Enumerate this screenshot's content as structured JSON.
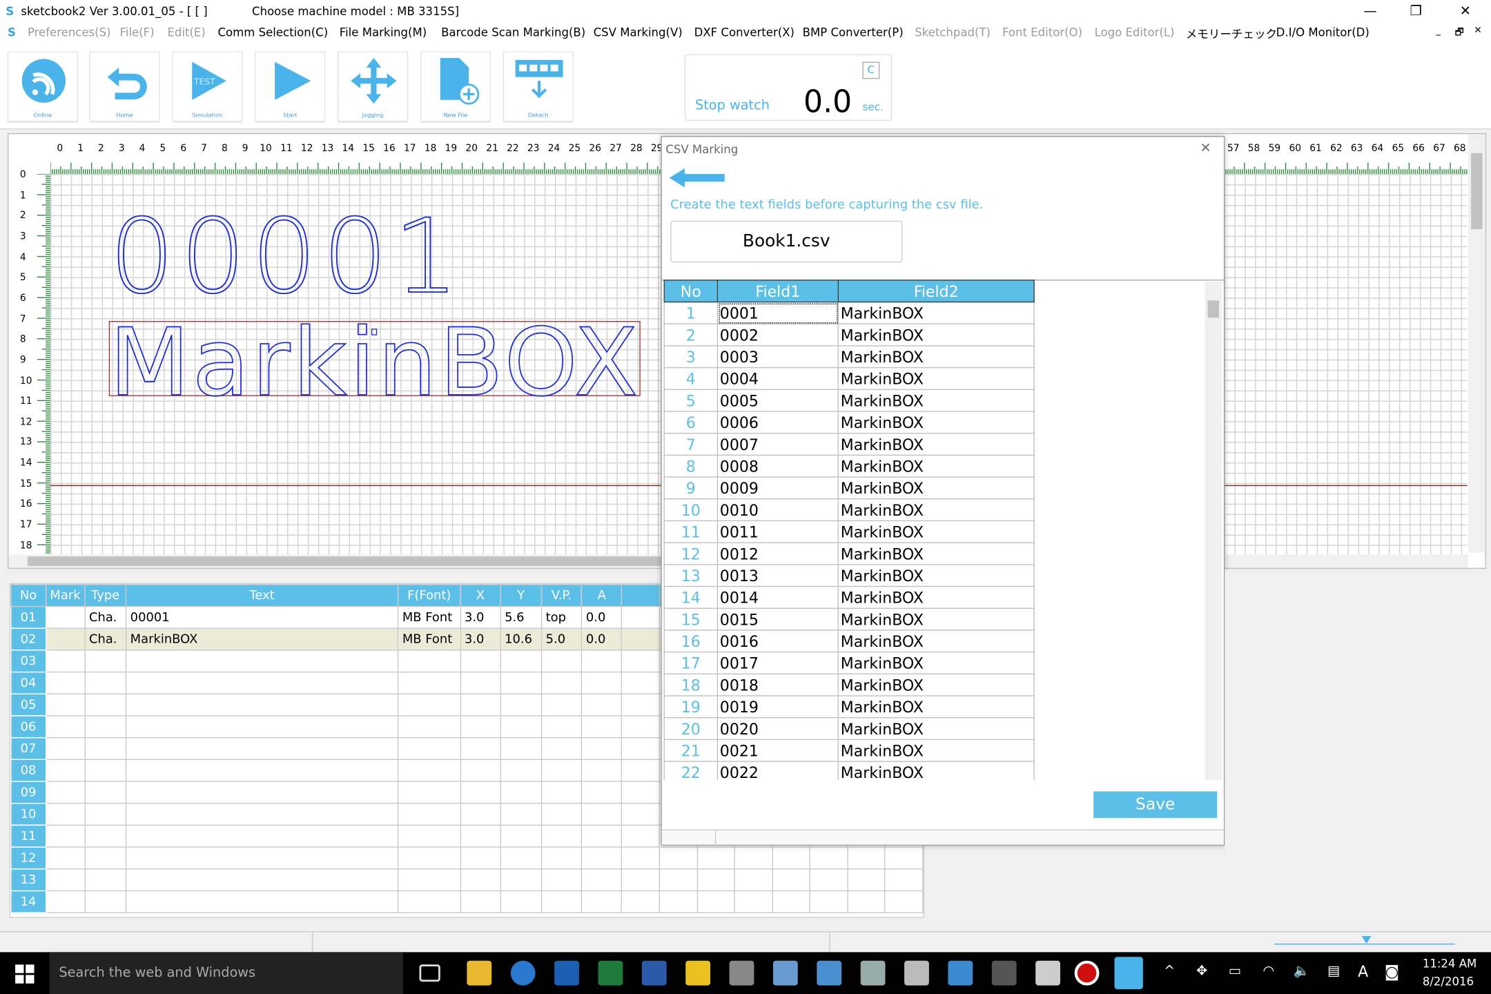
{
  "window": {
    "app_icon": "S",
    "title": "sketcbook2  Ver 3.00.01_05 - [ [     ]",
    "machine": "Choose machine model : MB 3315S]",
    "minimize": "—",
    "restore": "❐",
    "close": "✕"
  },
  "menu": {
    "icon": "S",
    "items": [
      {
        "label": "Preferences(S)",
        "enabled": false
      },
      {
        "label": "File(F)",
        "enabled": false
      },
      {
        "label": "Edit(E)",
        "enabled": false
      },
      {
        "label": "Comm Selection(C)",
        "enabled": true
      },
      {
        "label": "File Marking(M)",
        "enabled": true
      },
      {
        "label": "Barcode Scan Marking(B)",
        "enabled": true
      },
      {
        "label": "CSV Marking(V)",
        "enabled": true
      },
      {
        "label": "DXF Converter(X)",
        "enabled": true
      },
      {
        "label": "BMP Converter(P)",
        "enabled": true
      },
      {
        "label": "Sketchpad(T)",
        "enabled": false
      },
      {
        "label": "Font Editor(O)",
        "enabled": false
      },
      {
        "label": "Logo Editor(L)",
        "enabled": false
      },
      {
        "label": "メモリーチェック",
        "enabled": true
      },
      {
        "label": "D.I/O Monitor(D)",
        "enabled": true
      }
    ],
    "mdi": {
      "minimize": "_",
      "restore": "🗗",
      "close": "✕"
    }
  },
  "toolbar": {
    "buttons": [
      {
        "label": "Online",
        "icon": "wifi-icon"
      },
      {
        "label": "Home",
        "icon": "return-icon"
      },
      {
        "label": "Simulation",
        "icon": "test-play-icon",
        "badge": "TEST"
      },
      {
        "label": "Start",
        "icon": "play-icon"
      },
      {
        "label": "Jogging",
        "icon": "move-arrows-icon"
      },
      {
        "label": "New File",
        "icon": "new-file-icon"
      },
      {
        "label": "Detach",
        "icon": "detach-icon"
      }
    ]
  },
  "stopwatch": {
    "label": "Stop watch",
    "value": "0.0",
    "unit": "sec.",
    "clear": "C"
  },
  "canvas": {
    "ruler_x": [
      "0",
      "1",
      "2",
      "3",
      "4",
      "5",
      "6",
      "7",
      "8",
      "9",
      "10",
      "11",
      "12",
      "13",
      "14",
      "15",
      "16",
      "17",
      "18",
      "19",
      "20",
      "21",
      "22",
      "23",
      "24",
      "25",
      "26",
      "27",
      "28",
      "29",
      "57",
      "58",
      "59",
      "60",
      "61",
      "62",
      "63",
      "64",
      "65",
      "66",
      "67",
      "68"
    ],
    "ruler_y": [
      "0",
      "1",
      "2",
      "3",
      "4",
      "5",
      "6",
      "7",
      "8",
      "9",
      "10",
      "11",
      "12",
      "13",
      "14",
      "15",
      "16",
      "17",
      "18"
    ],
    "text1": "00001",
    "text2": "MarkinBOX"
  },
  "items_table": {
    "headers": [
      "No",
      "Mark",
      "Type",
      "Text",
      "F(Font)",
      "X",
      "Y",
      "V.P.",
      "A"
    ],
    "rows": [
      {
        "no": "01",
        "mark": "",
        "type": "Cha.",
        "text": "00001",
        "font": "MB Font",
        "x": "3.0",
        "y": "5.6",
        "vp": "top",
        "a": "0.0"
      },
      {
        "no": "02",
        "mark": "",
        "type": "Cha.",
        "text": "MarkinBOX",
        "font": "MB Font",
        "x": "3.0",
        "y": "10.6",
        "vp": "5.0",
        "a": "0.0"
      },
      {
        "no": "03"
      },
      {
        "no": "04"
      },
      {
        "no": "05"
      },
      {
        "no": "06"
      },
      {
        "no": "07"
      },
      {
        "no": "08"
      },
      {
        "no": "09"
      },
      {
        "no": "10"
      },
      {
        "no": "11"
      },
      {
        "no": "12"
      },
      {
        "no": "13"
      },
      {
        "no": "14"
      }
    ]
  },
  "csv_dialog": {
    "title": "CSV Marking",
    "close": "✕",
    "instruction": "Create the text fields before capturing the csv file.",
    "filename": "Book1.csv",
    "save": "Save",
    "headers": [
      "No",
      "Field1",
      "Field2"
    ],
    "rows": [
      [
        "1",
        "0001",
        "MarkinBOX"
      ],
      [
        "2",
        "0002",
        "MarkinBOX"
      ],
      [
        "3",
        "0003",
        "MarkinBOX"
      ],
      [
        "4",
        "0004",
        "MarkinBOX"
      ],
      [
        "5",
        "0005",
        "MarkinBOX"
      ],
      [
        "6",
        "0006",
        "MarkinBOX"
      ],
      [
        "7",
        "0007",
        "MarkinBOX"
      ],
      [
        "8",
        "0008",
        "MarkinBOX"
      ],
      [
        "9",
        "0009",
        "MarkinBOX"
      ],
      [
        "10",
        "0010",
        "MarkinBOX"
      ],
      [
        "11",
        "0011",
        "MarkinBOX"
      ],
      [
        "12",
        "0012",
        "MarkinBOX"
      ],
      [
        "13",
        "0013",
        "MarkinBOX"
      ],
      [
        "14",
        "0014",
        "MarkinBOX"
      ],
      [
        "15",
        "0015",
        "MarkinBOX"
      ],
      [
        "16",
        "0016",
        "MarkinBOX"
      ],
      [
        "17",
        "0017",
        "MarkinBOX"
      ],
      [
        "18",
        "0018",
        "MarkinBOX"
      ],
      [
        "19",
        "0019",
        "MarkinBOX"
      ],
      [
        "20",
        "0020",
        "MarkinBOX"
      ],
      [
        "21",
        "0021",
        "MarkinBOX"
      ],
      [
        "22",
        "0022",
        "MarkinBOX"
      ]
    ]
  },
  "taskbar": {
    "search": "Search the web and Windows",
    "time": "11:24 AM",
    "date": "8/2/2016",
    "ime": "A"
  }
}
